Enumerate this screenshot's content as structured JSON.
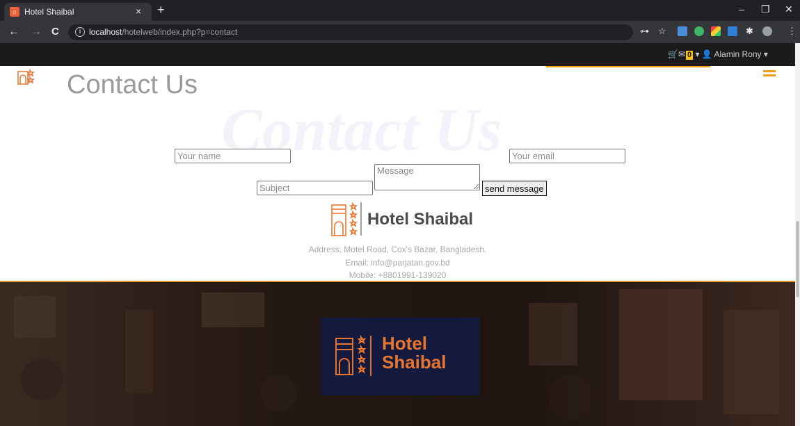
{
  "browser": {
    "tab_title": "Hotel Shaibal",
    "tab_close": "×",
    "new_tab": "+",
    "url_host": "localhost",
    "url_path": "/hotelweb/index.php?p=contact",
    "minimize": "–",
    "restore": "❐",
    "close": "✕",
    "back": "←",
    "forward": "→",
    "reload": "C",
    "info": "i"
  },
  "topbar": {
    "cart_count": "0",
    "user_name": "Alamin Rony"
  },
  "page": {
    "heading": "Contact Us",
    "watermark": "Contact Us"
  },
  "form": {
    "name_placeholder": "Your name",
    "email_placeholder": "Your email",
    "message_placeholder": "Message",
    "subject_placeholder": "Subject",
    "send_label": "send message"
  },
  "footer": {
    "hotel_name": "Hotel Shaibal",
    "address": "Address: Motel Road, Cox's Bazar, Bangladesh.",
    "email": "Email: info@parjatan.gov.bd",
    "mobile": "Mobile: +8801991-139020",
    "brand_line1": "Hotel",
    "brand_line2": "Shaibal"
  },
  "colors": {
    "accent": "#f39c12",
    "brand_orange": "#e8752f",
    "brand_navy": "#131a3d"
  }
}
